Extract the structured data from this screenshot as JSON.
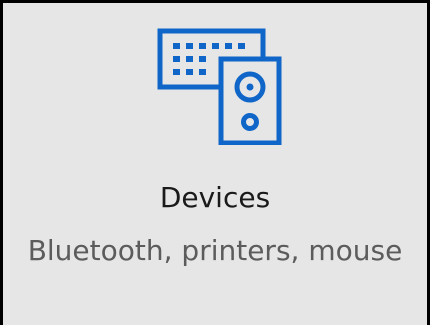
{
  "tile": {
    "title": "Devices",
    "description": "Bluetooth, printers, mouse",
    "icon": "devices-icon"
  },
  "colors": {
    "background": "#e6e6e6",
    "accent": "#0f66c8",
    "title_text": "#1a1a1a",
    "description_text": "#5c5c5c",
    "border": "#000000"
  }
}
